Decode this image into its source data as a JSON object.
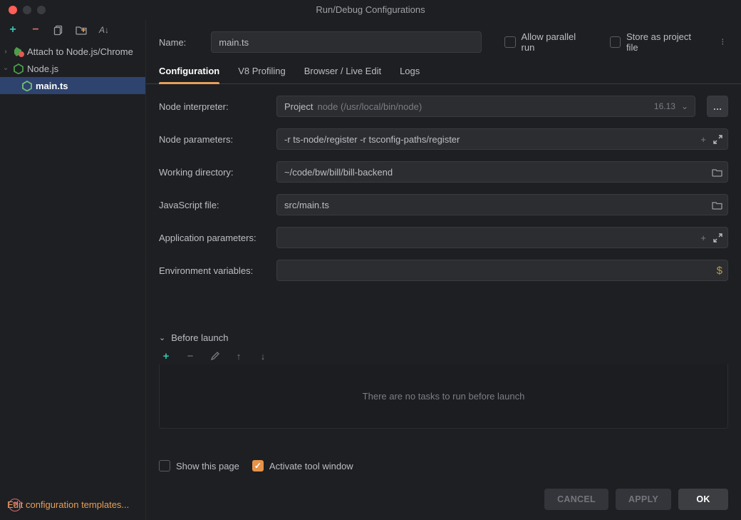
{
  "window": {
    "title": "Run/Debug Configurations"
  },
  "sidebar": {
    "items": [
      {
        "label": "Attach to Node.js/Chrome",
        "expanded": false,
        "icon": "node-chrome"
      },
      {
        "label": "Node.js",
        "expanded": true,
        "icon": "nodejs",
        "children": [
          {
            "label": "main.ts",
            "selected": true,
            "icon": "nodejs"
          }
        ]
      }
    ],
    "footer_link": "Edit configuration templates..."
  },
  "top": {
    "name_label": "Name:",
    "name_value": "main.ts",
    "parallel_label": "Allow parallel run",
    "store_label": "Store as project file"
  },
  "tabs": {
    "items": [
      "Configuration",
      "V8 Profiling",
      "Browser / Live Edit",
      "Logs"
    ],
    "active": 0
  },
  "form": {
    "node_interpreter": {
      "label": "Node interpreter:",
      "prefix": "Project",
      "path": "node (/usr/local/bin/node)",
      "version": "16.13"
    },
    "node_parameters": {
      "label": "Node parameters:",
      "value": "-r ts-node/register -r tsconfig-paths/register"
    },
    "working_directory": {
      "label": "Working directory:",
      "value": "~/code/bw/bill/bill-backend"
    },
    "javascript_file": {
      "label": "JavaScript file:",
      "value": "src/main.ts"
    },
    "application_parameters": {
      "label": "Application parameters:",
      "value": ""
    },
    "environment_variables": {
      "label": "Environment variables:",
      "value": ""
    }
  },
  "before_launch": {
    "heading": "Before launch",
    "empty_text": "There are no tasks to run before launch"
  },
  "bottom": {
    "show_page": "Show this page",
    "activate_tw": "Activate tool window",
    "activate_checked": true
  },
  "buttons": {
    "cancel": "CANCEL",
    "apply": "APPLY",
    "ok": "OK"
  }
}
